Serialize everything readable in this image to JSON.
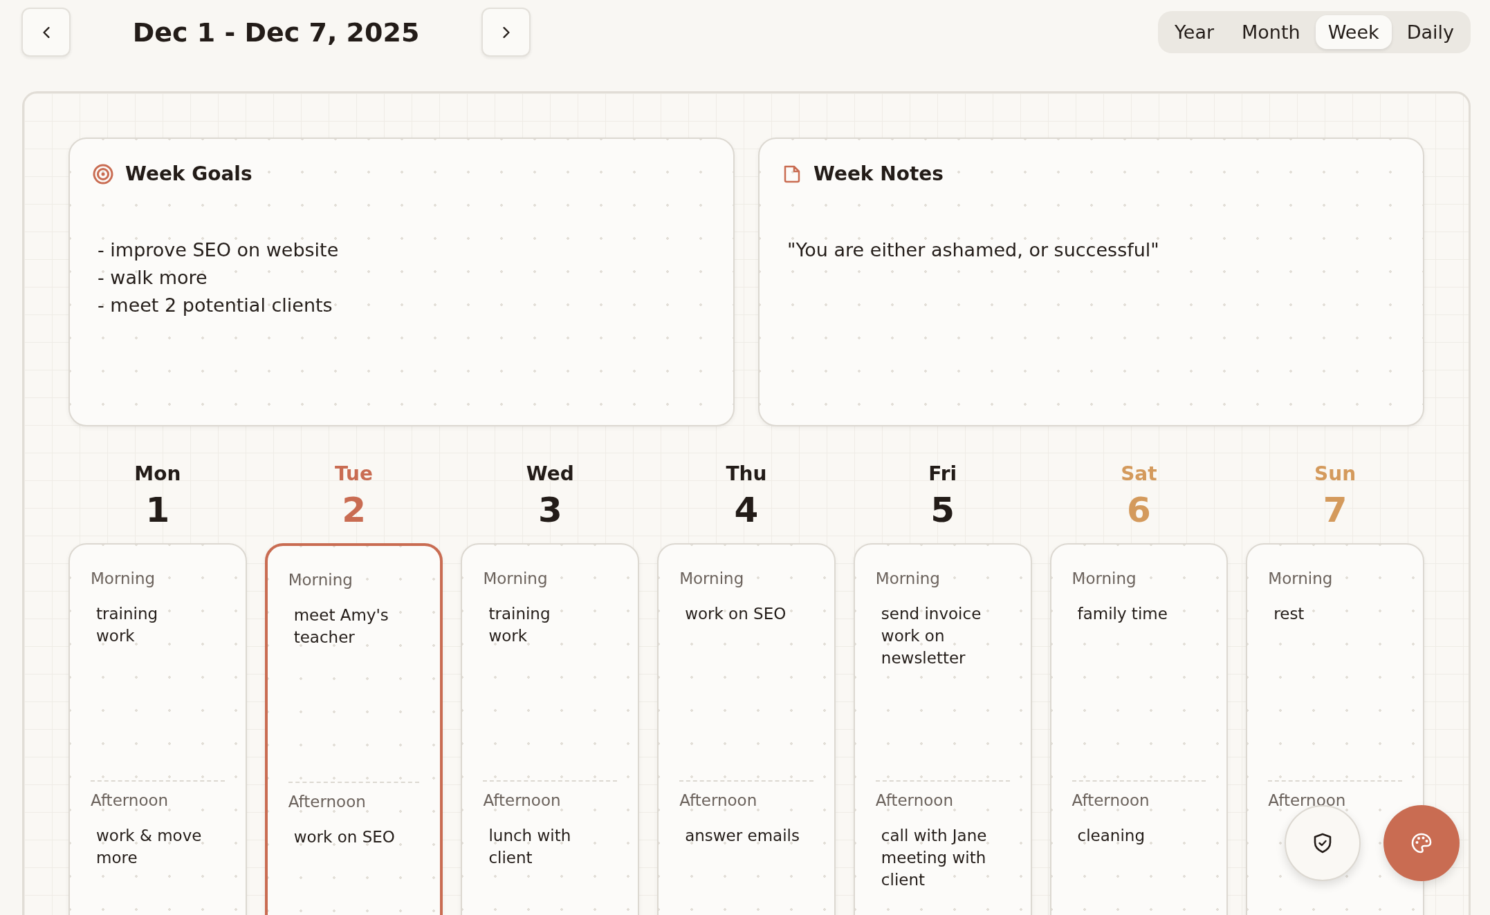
{
  "header": {
    "title": "Dec 1 - Dec 7, 2025"
  },
  "views": [
    {
      "label": "Year",
      "selected": false
    },
    {
      "label": "Month",
      "selected": false
    },
    {
      "label": "Week",
      "selected": true
    },
    {
      "label": "Daily",
      "selected": false
    }
  ],
  "goals": {
    "title": "Week Goals",
    "lines": [
      "- improve SEO on website",
      "- walk more",
      "- meet 2 potential clients"
    ]
  },
  "notes": {
    "title": "Week Notes",
    "lines": [
      "\"You are either ashamed, or successful\""
    ]
  },
  "days": [
    {
      "name": "Mon",
      "number": "1",
      "kind": "weekday",
      "selected": false,
      "morning_label": "Morning",
      "morning": [
        "training",
        "work"
      ],
      "afternoon_label": "Afternoon",
      "afternoon": [
        "work & move more"
      ]
    },
    {
      "name": "Tue",
      "number": "2",
      "kind": "today",
      "selected": true,
      "morning_label": "Morning",
      "morning": [
        "meet Amy's teacher"
      ],
      "afternoon_label": "Afternoon",
      "afternoon": [
        "work on SEO"
      ]
    },
    {
      "name": "Wed",
      "number": "3",
      "kind": "weekday",
      "selected": false,
      "morning_label": "Morning",
      "morning": [
        "training",
        "work"
      ],
      "afternoon_label": "Afternoon",
      "afternoon": [
        "lunch with client"
      ]
    },
    {
      "name": "Thu",
      "number": "4",
      "kind": "weekday",
      "selected": false,
      "morning_label": "Morning",
      "morning": [
        "work on SEO"
      ],
      "afternoon_label": "Afternoon",
      "afternoon": [
        "answer emails"
      ]
    },
    {
      "name": "Fri",
      "number": "5",
      "kind": "weekday",
      "selected": false,
      "morning_label": "Morning",
      "morning": [
        "send invoice",
        "work on newsletter"
      ],
      "afternoon_label": "Afternoon",
      "afternoon": [
        "call with Jane",
        "meeting with client"
      ]
    },
    {
      "name": "Sat",
      "number": "6",
      "kind": "weekend",
      "selected": false,
      "morning_label": "Morning",
      "morning": [
        "family time"
      ],
      "afternoon_label": "Afternoon",
      "afternoon": [
        "cleaning"
      ]
    },
    {
      "name": "Sun",
      "number": "7",
      "kind": "weekend",
      "selected": false,
      "morning_label": "Morning",
      "morning": [
        "rest"
      ],
      "afternoon_label": "Afternoon"
    }
  ]
}
